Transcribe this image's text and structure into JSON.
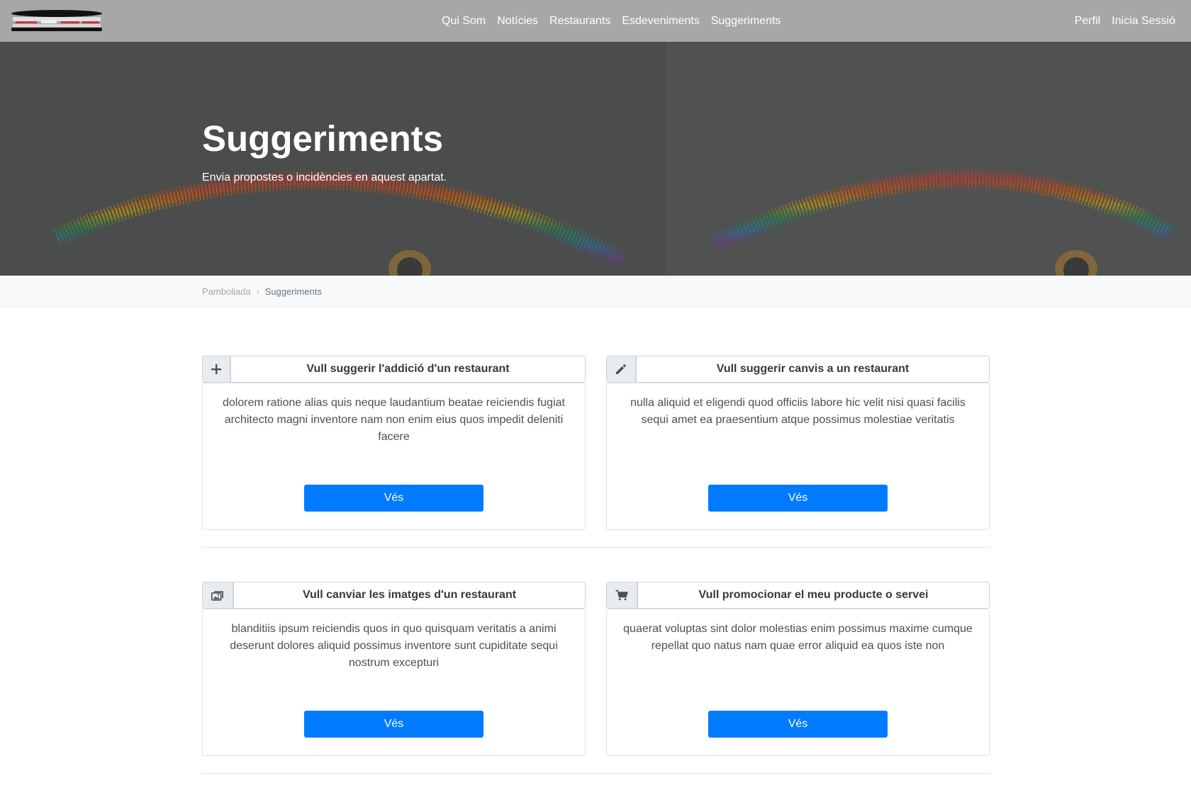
{
  "nav": {
    "links": [
      "Qui Som",
      "Notícies",
      "Restaurants",
      "Esdeveniments",
      "Suggeriments"
    ],
    "profile": "Perfil",
    "login": "Inicia Sessió"
  },
  "hero": {
    "title": "Suggeriments",
    "subtitle": "Envia propostes o incidències en aquest apartat."
  },
  "breadcrumb": {
    "home": "Pamboliada",
    "separator": "›",
    "current": "Suggeriments"
  },
  "cards": [
    {
      "icon": "plus-icon",
      "title": "Vull suggerir l'addició d'un restaurant",
      "text": "dolorem ratione alias quis neque laudantium beatae reiciendis fugiat architecto magni inventore nam non enim eius quos impedit deleniti facere",
      "button": "Vés"
    },
    {
      "icon": "pencil-icon",
      "title": "Vull suggerir canvis a un restaurant",
      "text": "nulla aliquid et eligendi quod officiis labore hic velit nisi quasi facilis sequi amet ea praesentium atque possimus molestiae veritatis",
      "button": "Vés"
    },
    {
      "icon": "images-icon",
      "title": "Vull canviar les imatges d'un restaurant",
      "text": "blanditiis ipsum reiciendis quos in quo quisquam veritatis a animi deserunt dolores aliquid possimus inventore sunt cupiditate sequi nostrum excepturi",
      "button": "Vés"
    },
    {
      "icon": "cart-icon",
      "title": "Vull promocionar el meu producte o servei",
      "text": "quaerat voluptas sint dolor molestias enim possimus maxime cumque repellat quo natus nam quae error aliquid ea quos iste non",
      "button": "Vés"
    }
  ],
  "colors": {
    "navbar": "#a7a7a7",
    "primary_button": "#007bff",
    "hero_overlay": "#4a4b4b"
  }
}
